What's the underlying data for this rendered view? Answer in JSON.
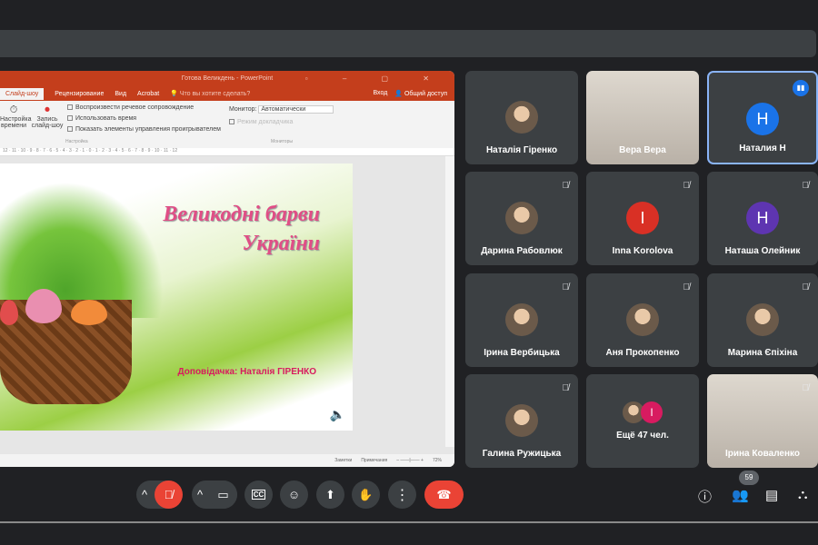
{
  "ppt": {
    "title": "Готова Великдень - PowerPoint",
    "tabs": [
      "Слайд-шоу",
      "Рецензирование",
      "Вид",
      "Acrobat"
    ],
    "tell_me": "Что вы хотите сделать?",
    "signin": "Вход",
    "share": "Общий доступ",
    "ribbon": {
      "rehearse": "Настройка времени",
      "record": "Запись слайд-шоу",
      "cb1": "Воспроизвести речевое сопровождение",
      "cb2": "Использовать время",
      "cb3": "Показать элементы управления проигрывателем",
      "group1": "Настройка",
      "monitor_label": "Монитор:",
      "monitor_value": "Автоматически",
      "presenter": "Режим докладчика",
      "group2": "Мониторы"
    },
    "ruler": "12 · 11 · 10 · 9 · 8 · 7 · 6 · 5 · 4 · 3 · 2 · 1 · 0 · 1 · 2 · 3 · 4 · 5 · 6 · 7 · 8 · 9 · 10 · 11 · 12",
    "slide": {
      "title_line1": "Великодні барви",
      "title_line2": "України",
      "speaker": "Доповідачка: Наталія ГІРЕНКО"
    },
    "status": {
      "notes": "Заметки",
      "comments": "Примечания",
      "zoom": "72%"
    }
  },
  "participants": [
    {
      "name": "Наталія Гіренко",
      "type": "photo",
      "muted": false
    },
    {
      "name": "Вера Вера",
      "type": "video",
      "muted": false
    },
    {
      "name": "Наталия Н",
      "type": "initial",
      "initial": "H",
      "color": "#1a73e8",
      "muted": false,
      "speaking": true
    },
    {
      "name": "Дарина Рабовлюк",
      "type": "photo",
      "muted": true
    },
    {
      "name": "Inna Korolova",
      "type": "initial",
      "initial": "I",
      "color": "#d93025",
      "muted": true
    },
    {
      "name": "Наташа Олейник",
      "type": "initial",
      "initial": "H",
      "color": "#5e35b1",
      "muted": true
    },
    {
      "name": "Ірина Вербицька",
      "type": "photo",
      "muted": true
    },
    {
      "name": "Аня Прокопенко",
      "type": "photo",
      "muted": true
    },
    {
      "name": "Марина Єпіхіна",
      "type": "photo",
      "muted": true
    },
    {
      "name": "Галина Ружицька",
      "type": "photo",
      "muted": true
    },
    {
      "name": "Ещё 47 чел.",
      "type": "more",
      "initial": "I",
      "muted": false
    },
    {
      "name": "Ірина Коваленко",
      "type": "video",
      "muted": true
    }
  ],
  "controls": {
    "people_count": "59",
    "captions": "CC"
  }
}
